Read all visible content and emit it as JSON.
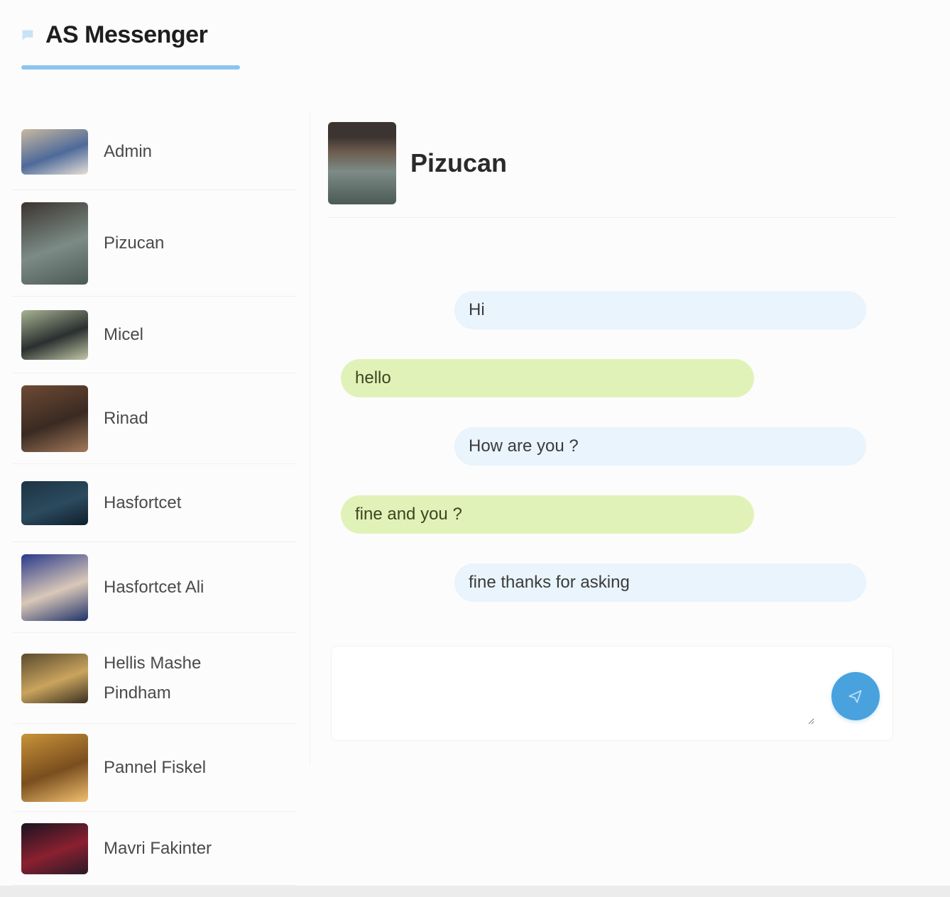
{
  "app": {
    "title": "AS Messenger"
  },
  "contacts": [
    {
      "name": "Admin",
      "colors": [
        "#c9b9a0",
        "#4e6a9a",
        "#e6e0d6"
      ]
    },
    {
      "name": "Pizucan",
      "colors": [
        "#3b3430",
        "#7c8b86",
        "#4c5a56"
      ]
    },
    {
      "name": "Micel",
      "colors": [
        "#a7b493",
        "#2b2f30",
        "#c2c8a6"
      ]
    },
    {
      "name": "Rinad",
      "colors": [
        "#6d4a34",
        "#3a2a22",
        "#a2795a"
      ]
    },
    {
      "name": "Hasfortcet",
      "colors": [
        "#1c3444",
        "#2c4a5e",
        "#0f1f2b"
      ]
    },
    {
      "name": "Hasfortcet Ali",
      "colors": [
        "#2a3a8a",
        "#d9c8b8",
        "#20326a"
      ]
    },
    {
      "name": "Hellis Mashe Pindham",
      "colors": [
        "#5a4a2e",
        "#c9a45e",
        "#3a3020"
      ]
    },
    {
      "name": "Pannel Fiskel",
      "colors": [
        "#c89338",
        "#7a4e1e",
        "#f0c070"
      ]
    },
    {
      "name": "Mavri Fakinter",
      "colors": [
        "#1a1420",
        "#8a2030",
        "#2a1a28"
      ]
    }
  ],
  "active_chat": {
    "name": "Pizucan"
  },
  "messages": [
    {
      "direction": "in",
      "text": "Hi"
    },
    {
      "direction": "out",
      "text": "hello"
    },
    {
      "direction": "in",
      "text": "How are you ?"
    },
    {
      "direction": "out",
      "text": "fine and you ?"
    },
    {
      "direction": "in",
      "text": "fine thanks for asking"
    }
  ],
  "composer": {
    "placeholder": "",
    "value": ""
  },
  "colors": {
    "accent": "#49a2de",
    "incoming_bubble": "#e9f4fc",
    "outgoing_bubble": "#e1f2b8"
  },
  "icons": {
    "brand": "chat-bubble-icon",
    "send": "send-icon"
  }
}
